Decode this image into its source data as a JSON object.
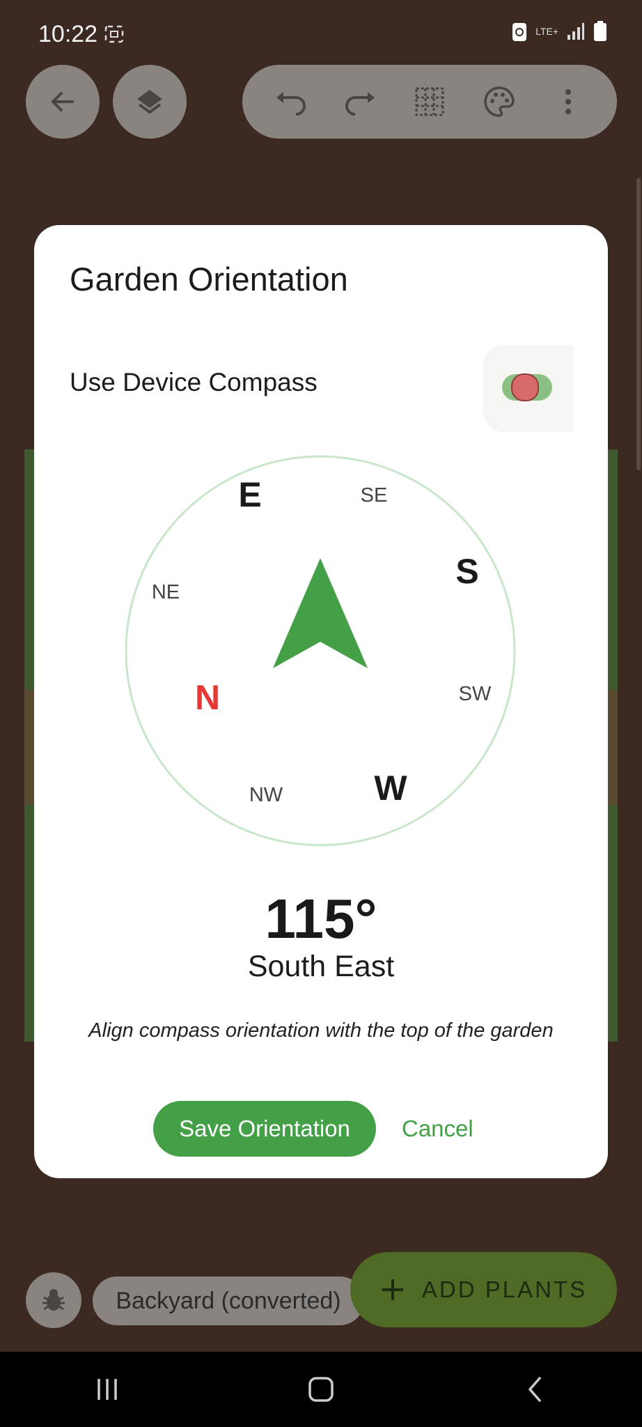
{
  "status": {
    "time": "10:22",
    "network": "LTE+"
  },
  "toolbar": {
    "back_icon": "arrow-left-icon",
    "layers_icon": "layers-icon",
    "undo_icon": "undo-icon",
    "redo_icon": "redo-icon",
    "grid_icon": "grid-icon",
    "palette_icon": "palette-icon",
    "more_icon": "more-vert-icon"
  },
  "dialog": {
    "title": "Garden Orientation",
    "toggle_label": "Use Device Compass",
    "toggle_on": true,
    "compass": {
      "heading_deg": 115,
      "labels": {
        "E": "E",
        "SE": "SE",
        "S": "S",
        "SW": "SW",
        "W": "W",
        "NW": "NW",
        "N": "N",
        "NE": "NE"
      }
    },
    "degrees_text": "115°",
    "direction_text": "South East",
    "hint": "Align compass orientation with the top of the garden",
    "save_label": "Save Orientation",
    "cancel_label": "Cancel"
  },
  "bottom": {
    "garden_name": "Backyard (converted)",
    "add_plants_label": "ADD PLANTS",
    "bug_icon": "bug-icon"
  },
  "colors": {
    "accent": "#43a047",
    "north": "#e53935",
    "background": "#3c2a22"
  }
}
